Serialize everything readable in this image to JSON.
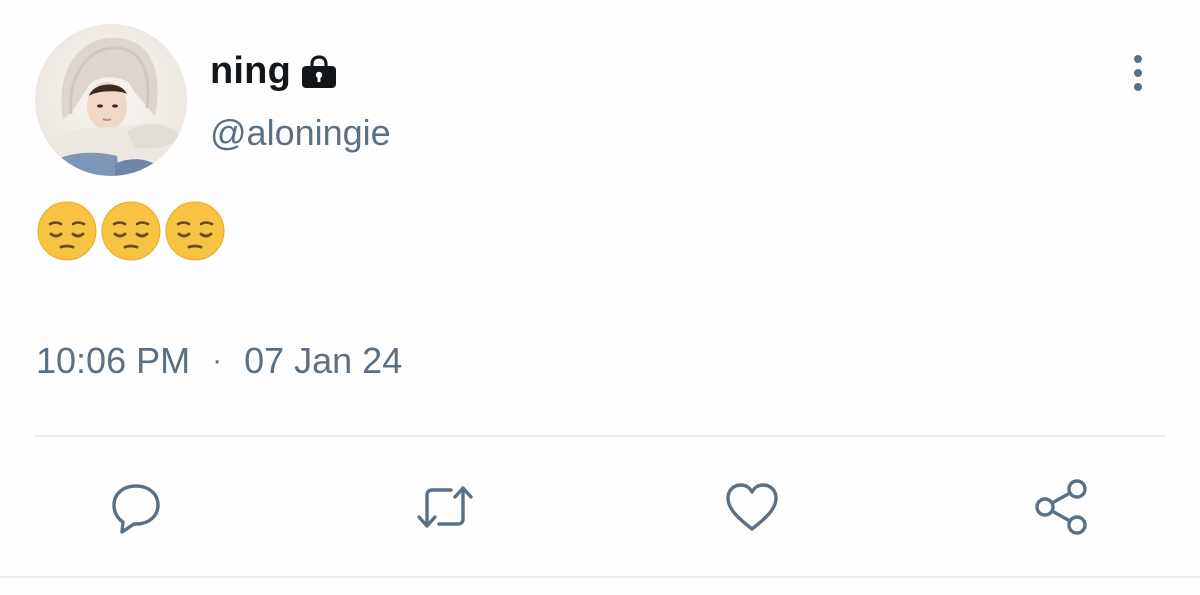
{
  "tweet": {
    "display_name": "ning",
    "handle": "@aloningie",
    "protected_icon": "lock-icon",
    "body_emojis": [
      "😔",
      "😔",
      "😔"
    ],
    "time": "10:06 PM",
    "separator": "·",
    "date": "07 Jan 24"
  },
  "actions": {
    "icons": [
      "reply-icon",
      "retweet-icon",
      "like-icon",
      "share-icon"
    ]
  },
  "colors": {
    "name": "#14171a",
    "secondary_text": "#5b7083",
    "icon": "#5b7083",
    "divider": "#e6ecf0",
    "emoji_face": "#f6c343"
  }
}
